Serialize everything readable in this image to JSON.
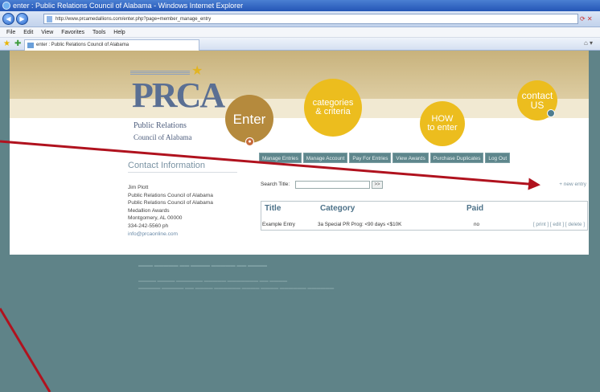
{
  "window": {
    "title": "enter : Public Relations Council of Alabama - Windows Internet Explorer"
  },
  "browser": {
    "url": "http://www.prcamedallions.com/enter.php?page=member_manage_entry",
    "menu": [
      "File",
      "Edit",
      "View",
      "Favorites",
      "Tools",
      "Help"
    ],
    "tab_title": "enter : Public Relations Council of Alabama"
  },
  "logo": {
    "text": "PRCA",
    "line1": "Public Relations",
    "line2": "Council of Alabama"
  },
  "circles": {
    "enter": "Enter",
    "categories": [
      "categories",
      "& criteria"
    ],
    "how": [
      "HOW",
      "to enter"
    ],
    "contact": [
      "contact",
      "US"
    ]
  },
  "nav": [
    "Manage Entries",
    "Manage Account",
    "Pay For Entries",
    "View Awards",
    "Purchase Duplicates",
    "Log Out"
  ],
  "contact": {
    "heading": "Contact Information",
    "lines": [
      "Jim Plott",
      "Public Relations Council of Alabama",
      "Public Relations Council of Alabama",
      "Medallion Awards",
      "Montgomery, AL 00000",
      "334-242-5560 ph"
    ],
    "email": "info@prcaonline.com"
  },
  "search": {
    "label": "Search Title:",
    "button": ">>",
    "new_entry": "+ new entry"
  },
  "entries": {
    "headers": [
      "Title",
      "Category",
      "Paid"
    ],
    "rows": [
      {
        "title": "Example Entry",
        "category": "3a Special PR Prog: <90 days <$10K",
        "paid": "no",
        "actions": "[ print ] [ edit ] [ delete ]"
      }
    ]
  },
  "colors": {
    "accent_gold": "#ecbd1e",
    "accent_bronze": "#b58a3d",
    "page_teal": "#5f8388",
    "arrow_red": "#b0121e"
  }
}
